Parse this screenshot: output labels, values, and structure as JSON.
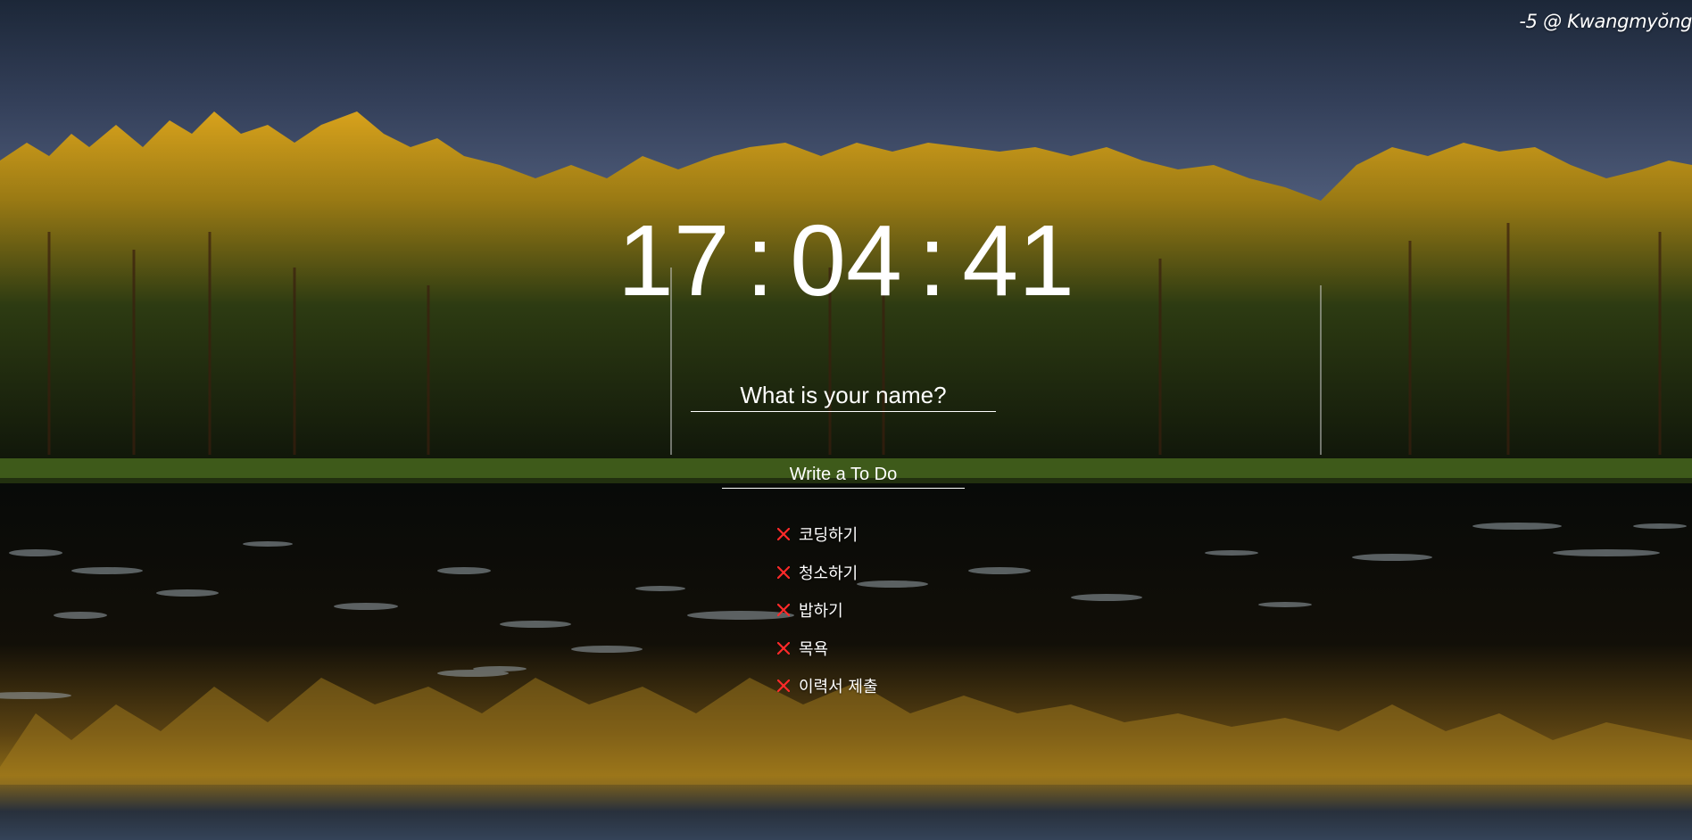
{
  "weather": {
    "text": "-5 @ Kwangmyŏng"
  },
  "clock": {
    "hours": "17",
    "minutes": "04",
    "seconds": "41",
    "separator": ":"
  },
  "name_form": {
    "placeholder": "What is your name?"
  },
  "todo_form": {
    "placeholder": "Write a To Do"
  },
  "todos": [
    {
      "text": "코딩하기",
      "delete_icon": "close-icon"
    },
    {
      "text": "청소하기",
      "delete_icon": "close-icon"
    },
    {
      "text": "밥하기",
      "delete_icon": "close-icon"
    },
    {
      "text": "목욕",
      "delete_icon": "close-icon"
    },
    {
      "text": "이력서 제출",
      "delete_icon": "close-icon"
    }
  ],
  "colors": {
    "text": "#ffffff",
    "delete_icon": "#ff2a2a"
  }
}
